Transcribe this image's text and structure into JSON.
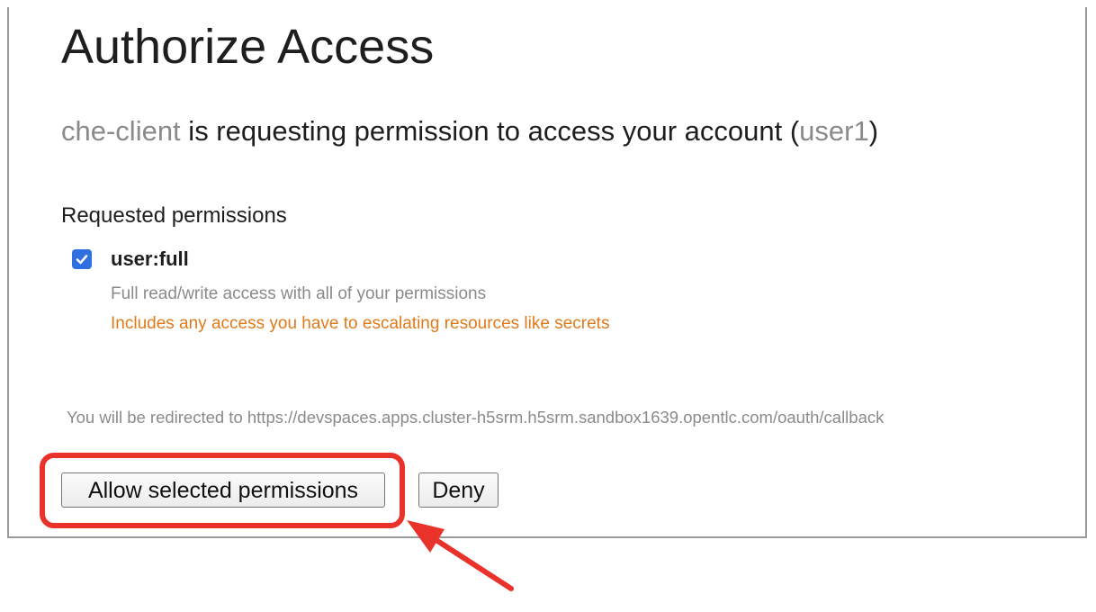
{
  "page": {
    "title": "Authorize Access",
    "request": {
      "client": "che-client",
      "text_before_user": " is requesting permission to access your account (",
      "user": "user1",
      "text_after_user": ")"
    },
    "permissions_heading": "Requested permissions",
    "permissions": [
      {
        "name": "user:full",
        "checked": true,
        "description": "Full read/write access with all of your permissions",
        "warning": "Includes any access you have to escalating resources like secrets"
      }
    ],
    "redirect_notice": "You will be redirected to https://devspaces.apps.cluster-h5srm.h5srm.sandbox1639.opentlc.com/oauth/callback",
    "buttons": {
      "allow_label": "Allow selected permissions",
      "deny_label": "Deny"
    }
  },
  "annotation": {
    "highlight_target": "allow-button",
    "color": "#e8322a"
  },
  "colors": {
    "muted_text": "#8a8a8a",
    "warning_text": "#e07a1a",
    "checkbox_blue": "#2f6fe0",
    "frame_border": "#9a9a9a"
  }
}
